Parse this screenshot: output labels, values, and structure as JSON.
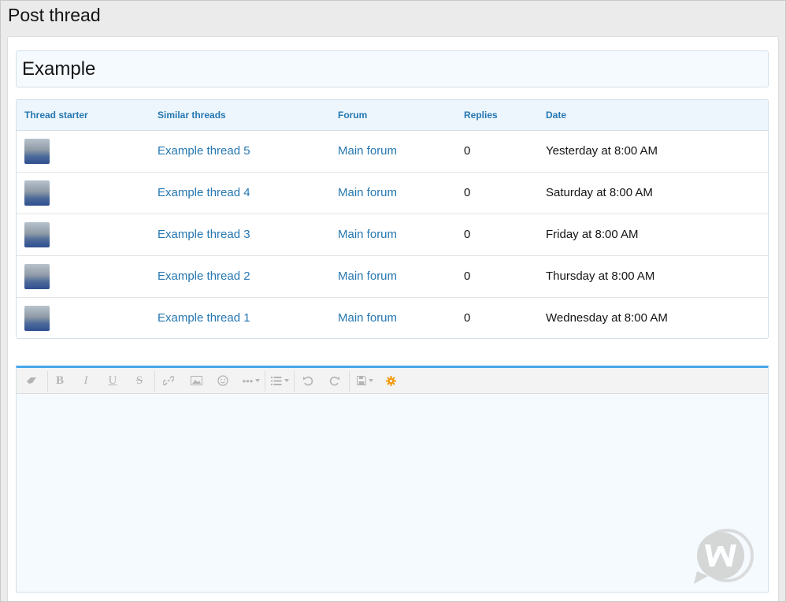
{
  "page": {
    "title": "Post thread"
  },
  "thread": {
    "title_value": "Example"
  },
  "similar_threads": {
    "columns": {
      "starter": "Thread starter",
      "similar": "Similar threads",
      "forum": "Forum",
      "replies": "Replies",
      "date": "Date"
    },
    "rows": [
      {
        "title": "Example thread 5",
        "forum": "Main forum",
        "replies": "0",
        "date": "Yesterday at 8:00 AM"
      },
      {
        "title": "Example thread 4",
        "forum": "Main forum",
        "replies": "0",
        "date": "Saturday at 8:00 AM"
      },
      {
        "title": "Example thread 3",
        "forum": "Main forum",
        "replies": "0",
        "date": "Friday at 8:00 AM"
      },
      {
        "title": "Example thread 2",
        "forum": "Main forum",
        "replies": "0",
        "date": "Thursday at 8:00 AM"
      },
      {
        "title": "Example thread 1",
        "forum": "Main forum",
        "replies": "0",
        "date": "Wednesday at 8:00 AM"
      }
    ]
  },
  "editor": {
    "toolbar": [
      "eraser-icon",
      "bold-icon",
      "italic-icon",
      "underline-icon",
      "strikethrough-icon",
      "link-icon",
      "image-icon",
      "smilie-icon",
      "more-icon",
      "list-icon",
      "undo-icon",
      "redo-icon",
      "save-draft-icon",
      "settings-gear-icon"
    ],
    "accent_color": "#47a7eb",
    "gear_color": "#f39c12"
  },
  "colors": {
    "link": "#2577b1",
    "header_bg": "#edf6fd",
    "input_bg": "#f5faff"
  }
}
